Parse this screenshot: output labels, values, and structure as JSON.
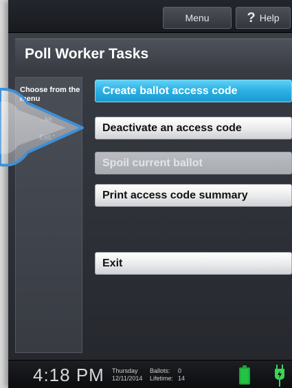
{
  "topbar": {
    "menu_label": "Menu",
    "help_icon_glyph": "?",
    "help_label": "Help"
  },
  "title": "Poll Worker Tasks",
  "sidebar": {
    "heading": "Choose from the menu",
    "ghost_text_1": "...ke",
    "ghost_text_2": "Exit.\""
  },
  "tasks": [
    {
      "label": "Create ballot access code",
      "state": "selected"
    },
    {
      "label": "Deactivate an access code",
      "state": "enabled"
    },
    {
      "label": "Spoil current ballot",
      "state": "disabled"
    },
    {
      "label": "Print access code summary",
      "state": "enabled"
    },
    {
      "label": "Exit",
      "state": "enabled"
    }
  ],
  "status": {
    "time": "4:18 PM",
    "day": "Thursday",
    "date": "12/11/2014",
    "ballots_label": "Ballots:",
    "ballots_value": "0",
    "lifetime_label": "Lifetime:",
    "lifetime_value": "14",
    "battery_icon": "battery-full-icon",
    "power_icon": "power-plug-icon"
  },
  "colors": {
    "accent": "#29abe2",
    "battery": "#22c443"
  }
}
